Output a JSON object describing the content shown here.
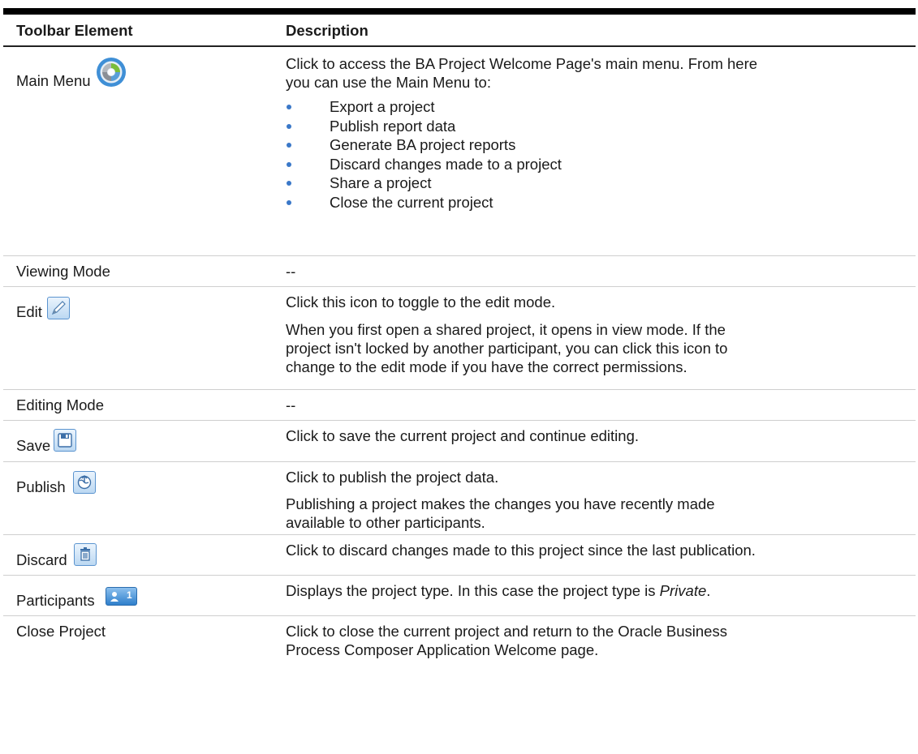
{
  "header": {
    "col1": "Toolbar Element",
    "col2": "Description"
  },
  "rows": {
    "main_menu": {
      "element": "Main Menu",
      "icon": "main-menu-icon",
      "desc": [
        "Click to access the BA Project Welcome Page's main menu. From here",
        "you can use the Main Menu to:"
      ],
      "bullets": [
        "Export a project",
        "Publish report data",
        "Generate BA project reports",
        "Discard changes made to a project",
        "Share a project",
        "Close the current project"
      ]
    },
    "viewing_mode": {
      "element": "Viewing Mode",
      "desc": "--"
    },
    "edit": {
      "element": "Edit",
      "icon": "pencil-icon",
      "desc1": "Click this icon to toggle to the edit mode.",
      "desc2": [
        "When you first open a shared project, it opens in view mode. If the",
        "project isn't locked by another participant, you can click this icon to",
        "change to the edit mode if you have the correct permissions."
      ]
    },
    "editing_mode": {
      "element": "Editing Mode",
      "desc": "--"
    },
    "save": {
      "element": "Save",
      "icon": "floppy-disk-icon",
      "desc": "Click to save the current project and continue editing."
    },
    "publish": {
      "element": "Publish",
      "icon": "publish-globe-icon",
      "desc1": "Click to publish the project data.",
      "desc2": [
        "Publishing a project makes the changes you have recently made",
        "available to other participants."
      ]
    },
    "discard": {
      "element": "Discard",
      "icon": "trash-icon",
      "desc": "Click to discard changes made to this project since the last publication."
    },
    "participants": {
      "element": "Participants",
      "icon": "participants-icon",
      "badge_count": "1",
      "desc_prefix": "Displays the project type. In this case the project type is ",
      "desc_em": "Private",
      "desc_suffix": "."
    },
    "close_project": {
      "element": "Close Project",
      "desc": [
        "Click to close the current project and return to the Oracle Business",
        "Process Composer Application Welcome page."
      ]
    }
  },
  "colors": {
    "accent": "#3a78c8",
    "rule": "#cfcfcf",
    "topbar": "#000000"
  }
}
